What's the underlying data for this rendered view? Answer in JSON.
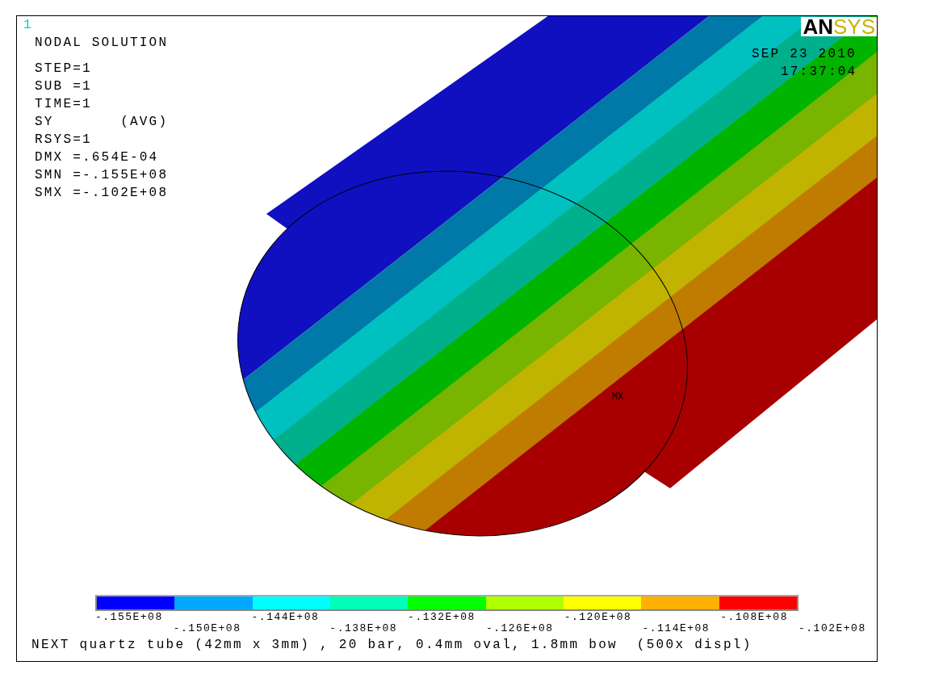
{
  "window_number": "1",
  "title": "NODAL SOLUTION",
  "info_lines": [
    "STEP=1",
    "SUB =1",
    "TIME=1",
    "SY       (AVG)",
    "RSYS=1",
    "DMX =.654E-04",
    "SMN =-.155E+08",
    "SMX =-.102E+08"
  ],
  "logo": {
    "dark": "AN",
    "light": "SYS"
  },
  "date": "SEP 23 2010",
  "time": "17:37:04",
  "marker": "MX",
  "legend": {
    "swatches": [
      {
        "color": "#0000ff"
      },
      {
        "color": "#00a8ff"
      },
      {
        "color": "#00ffff"
      },
      {
        "color": "#00ffb8"
      },
      {
        "color": "#00ff00"
      },
      {
        "color": "#b0ff00"
      },
      {
        "color": "#ffff00"
      },
      {
        "color": "#ffb000"
      },
      {
        "color": "#ff0000"
      }
    ],
    "labels": [
      "-.155E+08",
      "-.150E+08",
      "-.144E+08",
      "-.138E+08",
      "-.132E+08",
      "-.126E+08",
      "-.120E+08",
      "-.114E+08",
      "-.108E+08",
      "-.102E+08"
    ]
  },
  "caption": "NEXT quartz tube (42mm x 3mm) , 20 bar, 0.4mm oval, 1.8mm bow  (500x displ)"
}
